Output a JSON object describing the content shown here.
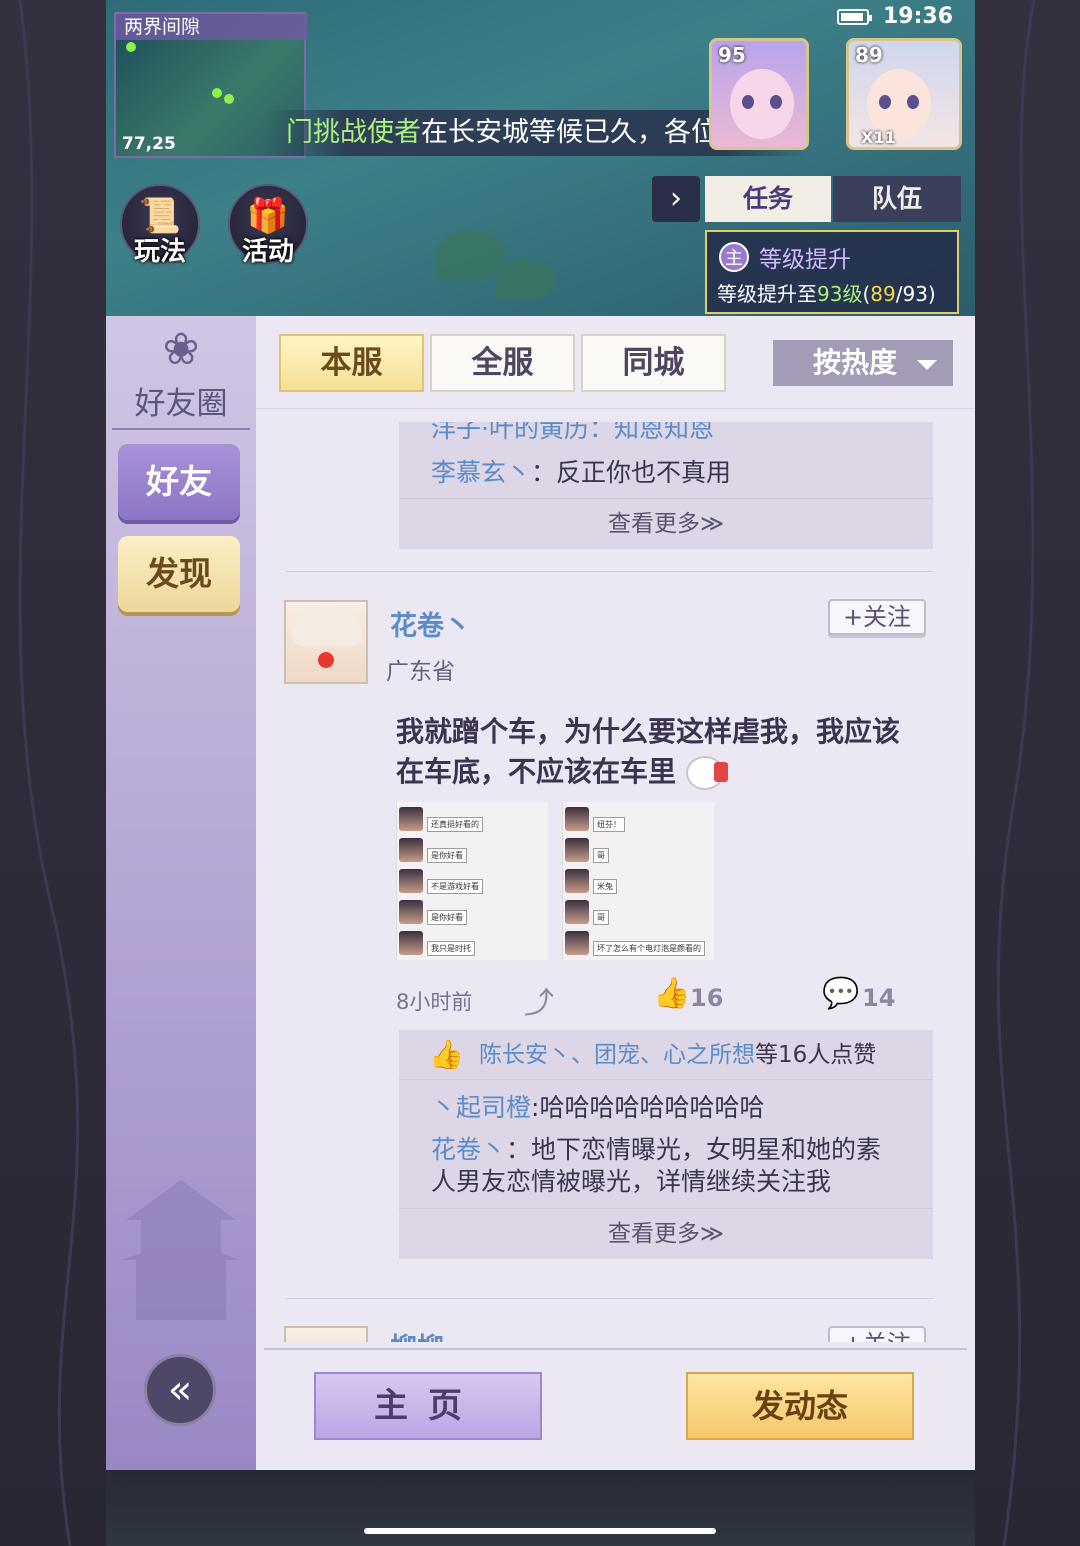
{
  "status": {
    "time": "19:36"
  },
  "game": {
    "minimap": {
      "title": "两界间隙",
      "coords": "77,25"
    },
    "marquee": {
      "highlight": "门挑战使者",
      "text": "在长安城等候已久，各位少侠"
    },
    "portraits": [
      {
        "level": "95"
      },
      {
        "level": "89",
        "badge": "X11"
      }
    ],
    "buttons": [
      {
        "label": "玩法"
      },
      {
        "label": "活动"
      }
    ],
    "tabs": {
      "arrow": "›",
      "task": "任务",
      "team": "队伍"
    },
    "quest": {
      "badge": "主",
      "title": "等级提升",
      "desc_prefix": "等级提升至",
      "target": "93级",
      "progress_open": "(",
      "current": "89",
      "progress_sep": "/",
      "total": "93",
      "progress_close": ")"
    }
  },
  "sidebar": {
    "brand_icon": "❀",
    "brand": "好友圈",
    "friends": "好友",
    "discover": "发现",
    "back_icon": "«"
  },
  "filters": {
    "local": "本服",
    "all": "全服",
    "city": "同城",
    "sort": "按热度"
  },
  "feed": {
    "first_comments": {
      "cut_line": "洋子·叶的黄历：知恩知恩",
      "line_name": "李慕玄丶",
      "line_sep": "：",
      "line_text": "反正你也不真用",
      "more": "查看更多≫"
    },
    "post": {
      "name": "花卷丶",
      "location": "广东省",
      "follow": "+关注",
      "text": "我就蹭个车，为什么要这样虐我，我应该在车底，不应该在车里",
      "images": [
        {
          "bubbles": [
            "还真挺好看的",
            "是你好看",
            "不是游戏好看",
            "是你好看",
            "我只是时托"
          ]
        },
        {
          "bubbles": [
            "纽芬！",
            "哥",
            "米兔",
            "哥",
            "坏了怎么有个电灯泡是颜看的"
          ]
        }
      ],
      "time": "8小时前",
      "share_icon": "share-icon",
      "likes": "16",
      "comments": "14",
      "like_names": "陈长安丶、团宠、心之所想",
      "like_suffix": "等16人点赞",
      "c1_name": "丶起司橙",
      "c1_sep": ":",
      "c1_text": "哈哈哈哈哈哈哈哈哈",
      "c2_name": "花卷丶",
      "c2_sep": "：",
      "c2_text": "地下恋情曝光，女明星和她的素人男友恋情被曝光，详情继续关注我",
      "more": "查看更多≫"
    },
    "next_post": {
      "name": "柳柳",
      "follow": "+关注"
    }
  },
  "bottom": {
    "home": "主页",
    "post": "发动态"
  }
}
